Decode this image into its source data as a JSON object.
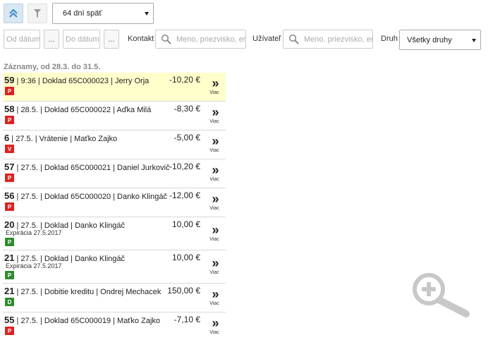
{
  "toolbar": {
    "collapse_icon": "double-chevron-up-icon",
    "filter_icon": "funnel-icon",
    "period_value": "64 dní späť"
  },
  "filters": {
    "from_placeholder": "Od dátumu",
    "to_placeholder": "Do dátumu",
    "dots_label": "...",
    "contact_label": "Kontakt",
    "contact_placeholder": "Meno, priezvisko, em",
    "user_label": "Užívateľ",
    "user_placeholder": "Meno, priezvisko, em",
    "type_label": "Druh",
    "type_value": "Všetky druhy"
  },
  "records_title": "Záznamy, od 28.3. do 31.5.",
  "more_label": "Viac",
  "records": [
    {
      "num": "59",
      "text": " | 9:36 | Doklad 65C000023 | Jerry Orja",
      "amount": "-10,20 €",
      "badge": "P",
      "badge_color": "#dd2222",
      "expiry": ""
    },
    {
      "num": "58",
      "text": " | 28.5. | Doklad 65C000022 | Aďka Milá",
      "amount": "-8,30 €",
      "badge": "P",
      "badge_color": "#dd2222",
      "expiry": ""
    },
    {
      "num": "6",
      "text": " | 27.5. | Vrátenie | Maťko Zajko",
      "amount": "-5,00 €",
      "badge": "V",
      "badge_color": "#dd2222",
      "expiry": ""
    },
    {
      "num": "57",
      "text": " | 27.5. | Doklad 65C000021 | Daniel Jurkovič",
      "amount": "-10,20 €",
      "badge": "P",
      "badge_color": "#dd2222",
      "expiry": ""
    },
    {
      "num": "56",
      "text": " | 27.5. | Doklad 65C000020 | Danko Klingáč",
      "amount": "-12,00 €",
      "badge": "P",
      "badge_color": "#dd2222",
      "expiry": ""
    },
    {
      "num": "20",
      "text": " | 27.5. | Doklad | Danko Klingáč",
      "amount": "10,00 €",
      "badge": "P",
      "badge_color": "#2e8b2e",
      "expiry": "Expirácia 27.5.2017"
    },
    {
      "num": "21",
      "text": " | 27.5. | Doklad | Danko Klingáč",
      "amount": "10,00 €",
      "badge": "P",
      "badge_color": "#2e8b2e",
      "expiry": "Expirácia 27.5.2017"
    },
    {
      "num": "21",
      "text": " | 27.5. | Dobitie kreditu | Ondrej Mechacek",
      "amount": "150,00 €",
      "badge": "D",
      "badge_color": "#2e8b2e",
      "expiry": ""
    },
    {
      "num": "55",
      "text": " | 27.5. | Doklad 65C000019 | Maťko Zajko",
      "amount": "-7,10 €",
      "badge": "P",
      "badge_color": "#dd2222",
      "expiry": ""
    }
  ],
  "zoom_icon": "zoom-in-magnifier-icon"
}
